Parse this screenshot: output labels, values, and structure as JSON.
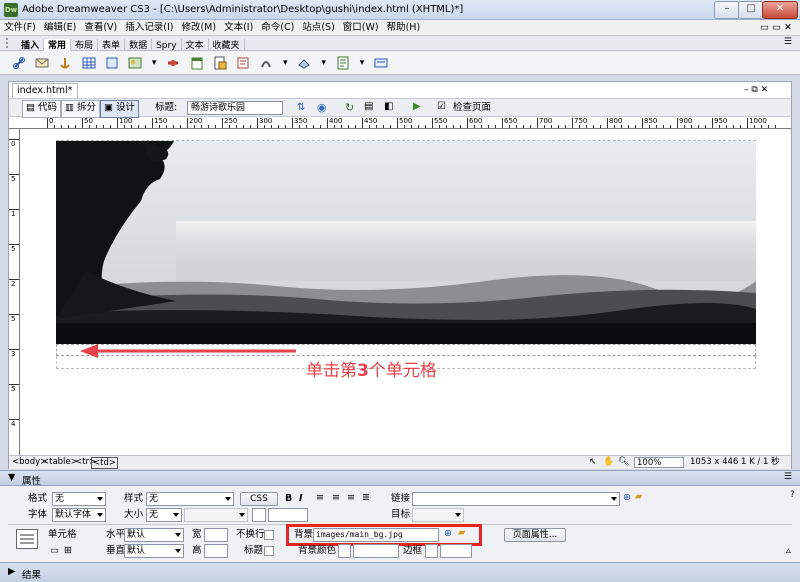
{
  "window": {
    "title": "Adobe Dreamweaver CS3 - [C:\\Users\\Administrator\\Desktop\\gushi\\index.html (XHTML)*]",
    "app_icon": "Dw"
  },
  "menu": [
    "文件(F)",
    "编辑(E)",
    "查看(V)",
    "插入记录(I)",
    "修改(M)",
    "文本(I)",
    "命令(C)",
    "站点(S)",
    "窗口(W)",
    "帮助(H)"
  ],
  "insert_bar": {
    "tabs": [
      "插入",
      "常用",
      "布局",
      "表单",
      "数据",
      "Spry",
      "文本",
      "收藏夹"
    ],
    "active_tab": "常用"
  },
  "document": {
    "tab_label": "index.html*",
    "views": {
      "code": "代码",
      "split": "拆分",
      "design": "设计"
    },
    "title_label": "标题:",
    "title_value": "畅游诗歌乐园",
    "check_page": "检查页面"
  },
  "ruler": {
    "labels": [
      "0",
      "50",
      "100",
      "150",
      "200",
      "250",
      "300",
      "350",
      "400",
      "450",
      "500",
      "550",
      "600",
      "650",
      "700",
      "750",
      "800",
      "850",
      "900",
      "950",
      "1000"
    ],
    "v_labels": [
      "0",
      "5",
      "1",
      "5",
      "2",
      "5",
      "3",
      "5",
      "4"
    ]
  },
  "annotation": {
    "text_before": "单击第",
    "text_num": "3",
    "text_after": "个单元格",
    "color": "#e8424a"
  },
  "status": {
    "tags": [
      "<body>",
      "<table>",
      "<tr>",
      "<td>"
    ],
    "zoom": "100%",
    "dimensions": "1053 x 446",
    "size": "1 K / 1 秒"
  },
  "properties": {
    "header": "属性",
    "format_label": "格式",
    "format_value": "无",
    "style_label": "样式",
    "style_value": "无",
    "css_button": "CSS",
    "bold": "B",
    "italic": "I",
    "link_label": "链接",
    "font_label": "字体",
    "font_value": "默认字体",
    "size_label": "大小",
    "size_value": "无",
    "target_label": "目标",
    "cell_label": "单元格",
    "h_align_label": "水平",
    "h_align_value": "默认",
    "v_align_label": "垂直",
    "v_align_value": "默认",
    "width_label": "宽",
    "height_label": "高",
    "nowrap_label": "不换行",
    "header_label": "标题",
    "bg_label": "背景",
    "bg_value": "images/main_bg.jpg",
    "bgcolor_label": "背景颜色",
    "border_label": "边框",
    "page_props_button": "页面属性..."
  },
  "results_panel": "结果"
}
